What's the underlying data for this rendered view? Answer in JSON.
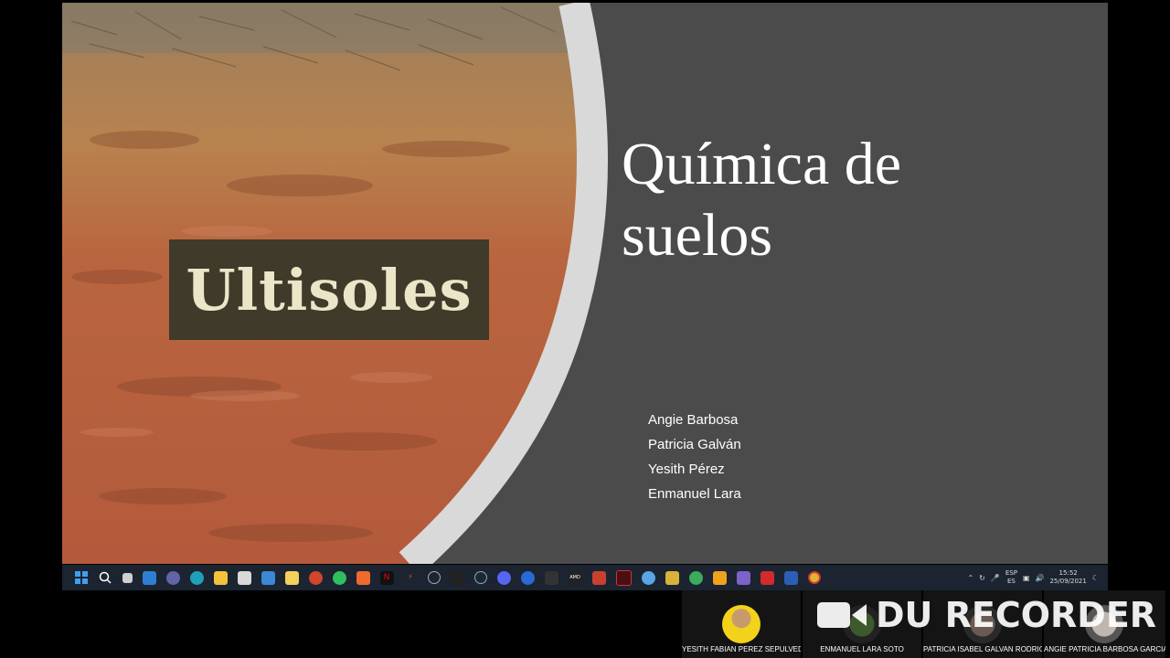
{
  "slide": {
    "label": "Ultisoles",
    "title_line1": "Química de",
    "title_line2": "suelos",
    "authors": [
      "Angie Barbosa",
      "Patricia Galván",
      "Yesith Pérez",
      "Enmanuel Lara"
    ]
  },
  "taskbar": {
    "icons": [
      "windows-start-icon",
      "search-icon",
      "task-view-icon",
      "widgets-icon",
      "teams-chat-icon",
      "edge-icon",
      "file-explorer-icon",
      "store-icon",
      "mail-icon",
      "gmail-icon",
      "powerpoint-icon",
      "whatsapp-icon",
      "brave-icon",
      "netflix-icon",
      "app-red-icon",
      "app-gray-icon",
      "app-dark-icon",
      "steam-icon",
      "discord-icon",
      "app-blue-icon",
      "epic-games-icon",
      "amd-icon",
      "app-red2-icon",
      "app-vivaldi-icon",
      "app-circle-icon",
      "app-yellow-icon",
      "app-green-icon",
      "app-orange-icon",
      "teams-icon",
      "acrobat-icon",
      "word-icon",
      "chrome-icon"
    ],
    "lang": "ESP",
    "lang_sub": "ES",
    "time": "15:52",
    "date": "25/09/2021"
  },
  "participants": [
    {
      "name": "YESITH FABIAN PEREZ SEPULVEDA"
    },
    {
      "name": "ENMANUEL LARA SOTO"
    },
    {
      "name": "PATRICIA ISABEL GALVAN RODRIG..."
    },
    {
      "name": "ANGIE PATRICIA BARBOSA GARCIA"
    }
  ],
  "watermark": "DU RECORDER",
  "colors": {
    "slide_bg": "#4b4b4b",
    "soil": "#b5603f",
    "arc": "#d9d9d9",
    "taskbar": "#1b2430"
  }
}
